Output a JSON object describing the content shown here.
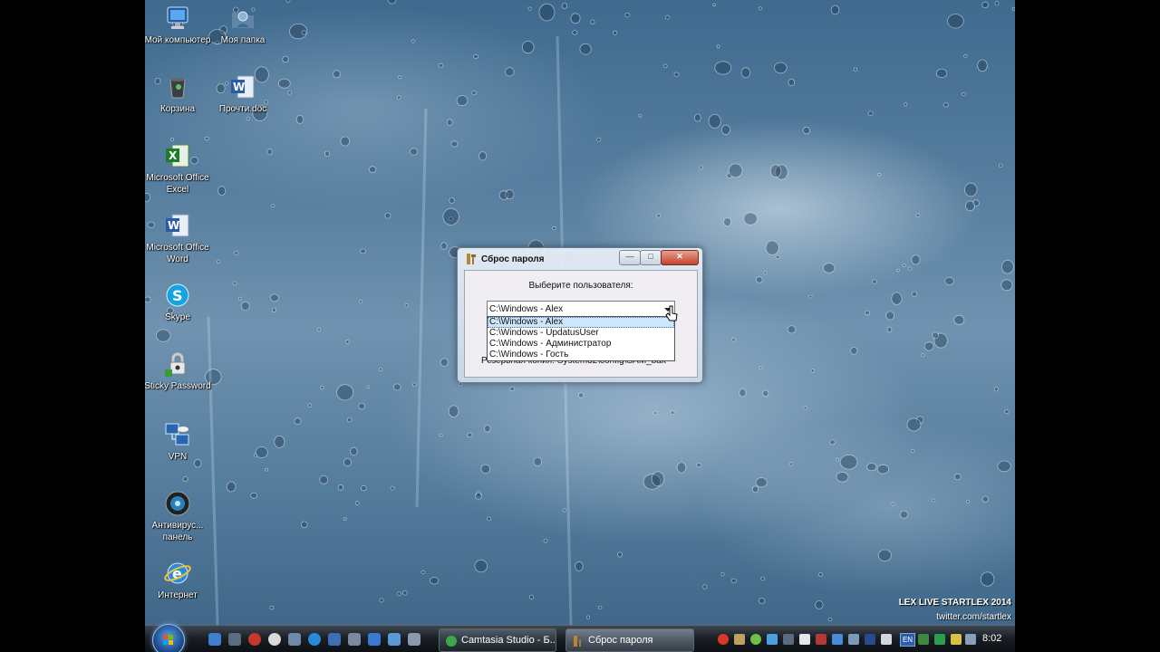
{
  "desktop": {
    "icons": [
      {
        "label": "Мой компьютер"
      },
      {
        "label": "Моя папка"
      },
      {
        "label": "Корзина"
      },
      {
        "label": "Прочти.doc"
      },
      {
        "label": "Microsoft Office Excel"
      },
      {
        "label": "Microsoft Office Word"
      },
      {
        "label": "Skype"
      },
      {
        "label": "Sticky Password"
      },
      {
        "label": "VPN"
      },
      {
        "label": "Антивирус... панель"
      },
      {
        "label": "Интернет"
      }
    ],
    "watermark_line1": "LEX LIVE STARTLEX 2014",
    "watermark_line2": "twitter.com/startlex"
  },
  "dialog": {
    "title": "Сброс пароля",
    "minimize_label": "—",
    "maximize_label": "□",
    "close_label": "✕",
    "prompt": "Выберите пользователя:",
    "selected_user": "C:\\Windows - Alex",
    "options": [
      "C:\\Windows - Alex",
      "C:\\Windows - UpdatusUser",
      "C:\\Windows - Администратор",
      "C:\\Windows - Гость"
    ],
    "backup_text": "Резервная копия: System32\\config\\SAM_bak"
  },
  "taskbar": {
    "tasks": [
      {
        "label": "Camtasia Studio - Б..."
      },
      {
        "label": "Сброс пароля"
      }
    ],
    "language": "EN",
    "clock": "8:02"
  },
  "colors": {
    "accent": "#1d4c8c",
    "close_button": "#c4422d",
    "selection": "#cde6fb"
  }
}
